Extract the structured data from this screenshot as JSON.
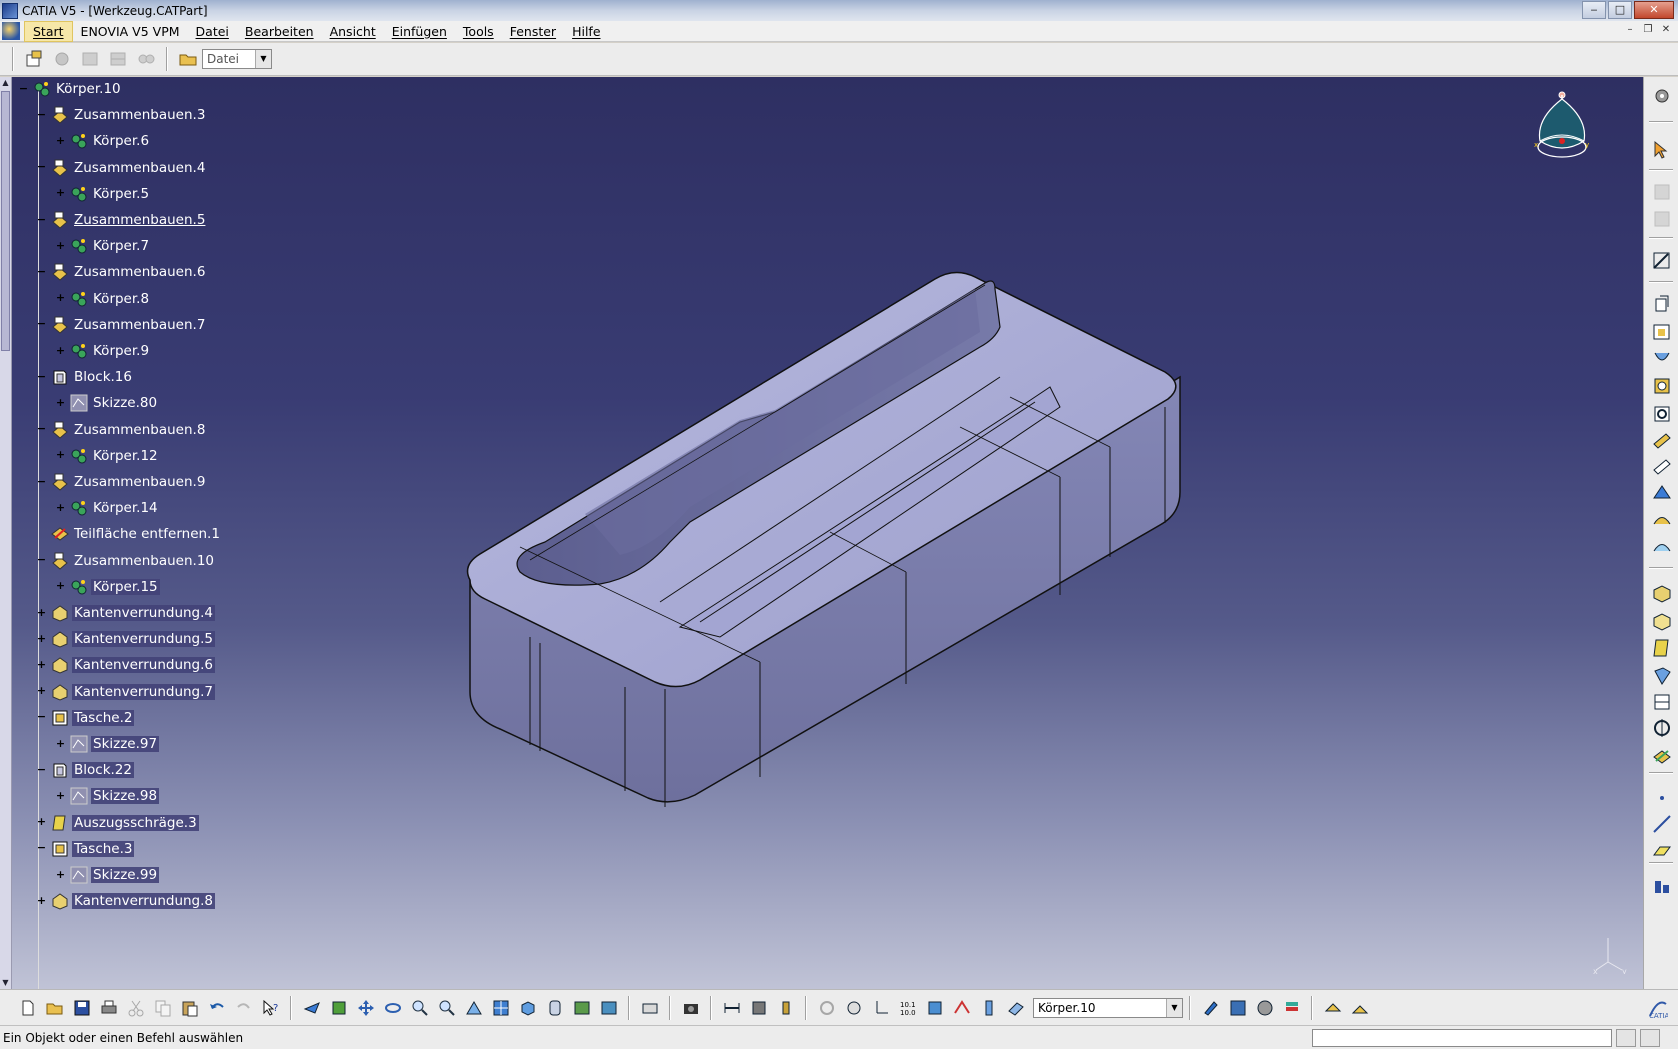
{
  "window": {
    "title": "CATIA V5 - [Werkzeug.CATPart]",
    "controls": {
      "minimize": "‒",
      "maximize": "□",
      "close": "✕"
    }
  },
  "menubar": {
    "items": [
      {
        "label": "Start"
      },
      {
        "label": "ENOVIA V5 VPM"
      },
      {
        "label": "Datei"
      },
      {
        "label": "Bearbeiten"
      },
      {
        "label": "Ansicht"
      },
      {
        "label": "Einfügen"
      },
      {
        "label": "Tools"
      },
      {
        "label": "Fenster"
      },
      {
        "label": "Hilfe"
      }
    ],
    "mdi_controls": {
      "minimize": "–",
      "restore": "❐",
      "close": "✕"
    }
  },
  "top_toolbar": {
    "file_combo": {
      "value": "Datei"
    }
  },
  "tree": {
    "root": {
      "label": "Körper.10",
      "icon": "body-icon"
    },
    "items": [
      {
        "label": "Zusammenbauen.3",
        "icon": "assemble-icon",
        "level": 1,
        "expander": "−"
      },
      {
        "label": "Körper.6",
        "icon": "body-icon",
        "level": 2,
        "expander": "+"
      },
      {
        "label": "Zusammenbauen.4",
        "icon": "assemble-icon",
        "level": 1,
        "expander": "−"
      },
      {
        "label": "Körper.5",
        "icon": "body-icon",
        "level": 2,
        "expander": "+"
      },
      {
        "label": "Zusammenbauen.5",
        "icon": "assemble-icon",
        "level": 1,
        "expander": "−",
        "underlined": true
      },
      {
        "label": "Körper.7",
        "icon": "body-icon",
        "level": 2,
        "expander": "+"
      },
      {
        "label": "Zusammenbauen.6",
        "icon": "assemble-icon",
        "level": 1,
        "expander": "−"
      },
      {
        "label": "Körper.8",
        "icon": "body-icon",
        "level": 2,
        "expander": "+"
      },
      {
        "label": "Zusammenbauen.7",
        "icon": "assemble-icon",
        "level": 1,
        "expander": "−"
      },
      {
        "label": "Körper.9",
        "icon": "body-icon",
        "level": 2,
        "expander": "+"
      },
      {
        "label": "Block.16",
        "icon": "pad-icon",
        "level": 1,
        "expander": "−"
      },
      {
        "label": "Skizze.80",
        "icon": "sketch-icon",
        "level": 2,
        "expander": "+"
      },
      {
        "label": "Zusammenbauen.8",
        "icon": "assemble-icon",
        "level": 1,
        "expander": "−"
      },
      {
        "label": "Körper.12",
        "icon": "body-icon",
        "level": 2,
        "expander": "+"
      },
      {
        "label": "Zusammenbauen.9",
        "icon": "assemble-icon",
        "level": 1,
        "expander": "−"
      },
      {
        "label": "Körper.14",
        "icon": "body-icon",
        "level": 2,
        "expander": "+"
      },
      {
        "label": "Teilfläche entfernen.1",
        "icon": "remove-face-icon",
        "level": 1,
        "expander": ""
      },
      {
        "label": "Zusammenbauen.10",
        "icon": "assemble-icon",
        "level": 1,
        "expander": "−"
      },
      {
        "label": "Körper.15",
        "icon": "body-icon",
        "level": 2,
        "expander": "+"
      },
      {
        "label": "Kantenverrundung.4",
        "icon": "edge-fillet-icon",
        "level": 1,
        "expander": "+"
      },
      {
        "label": "Kantenverrundung.5",
        "icon": "edge-fillet-icon",
        "level": 1,
        "expander": "+"
      },
      {
        "label": "Kantenverrundung.6",
        "icon": "edge-fillet-icon",
        "level": 1,
        "expander": "+"
      },
      {
        "label": "Kantenverrundung.7",
        "icon": "edge-fillet-icon",
        "level": 1,
        "expander": "+"
      },
      {
        "label": "Tasche.2",
        "icon": "pocket-icon",
        "level": 1,
        "expander": "−"
      },
      {
        "label": "Skizze.97",
        "icon": "sketch-icon",
        "level": 2,
        "expander": "+"
      },
      {
        "label": "Block.22",
        "icon": "pad-icon",
        "level": 1,
        "expander": "−"
      },
      {
        "label": "Skizze.98",
        "icon": "sketch-icon",
        "level": 2,
        "expander": "+"
      },
      {
        "label": "Auszugsschräge.3",
        "icon": "draft-icon",
        "level": 1,
        "expander": "+"
      },
      {
        "label": "Tasche.3",
        "icon": "pocket-icon",
        "level": 1,
        "expander": "−"
      },
      {
        "label": "Skizze.99",
        "icon": "sketch-icon",
        "level": 2,
        "expander": "+"
      },
      {
        "label": "Kantenverrundung.8",
        "icon": "edge-fillet-icon",
        "level": 1,
        "expander": "+"
      }
    ]
  },
  "bottom_toolbar": {
    "body_combo": {
      "value": "Körper.10"
    }
  },
  "status": {
    "message": "Ein Objekt oder einen Befehl auswählen",
    "power_input": ""
  },
  "colors": {
    "viewport_top": "#2e2f62",
    "viewport_bottom": "#c0c3d6",
    "part_face": "#a9abd8",
    "part_side": "#7a7ca8",
    "tree_highlight": "#424378"
  }
}
